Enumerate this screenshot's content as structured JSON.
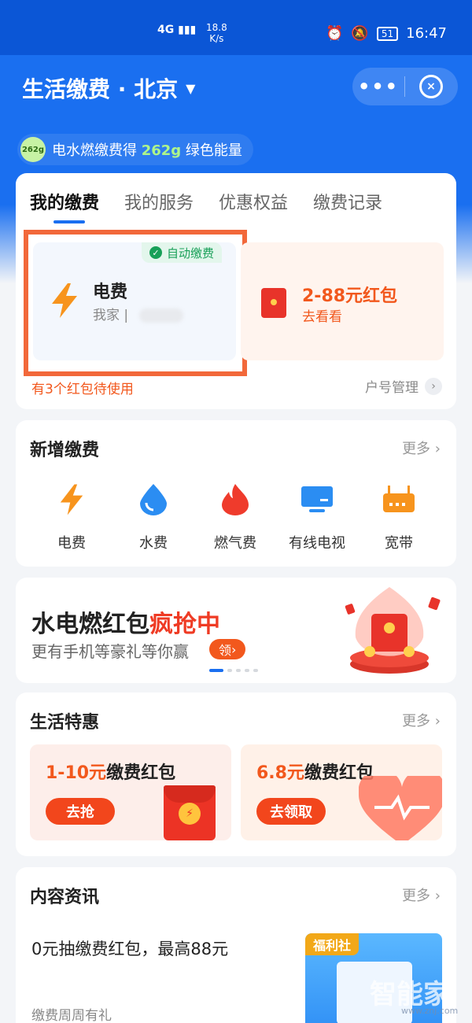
{
  "status_bar": {
    "network": "4G",
    "speed_value": "18.8",
    "speed_unit": "K/s",
    "battery": "51",
    "time": "16:47"
  },
  "header": {
    "title": "生活缴费 · 北京",
    "capsule_more": "•••"
  },
  "energy_pill": {
    "badge": "262g",
    "text_before": "电水燃缴费得 ",
    "amount": "262g",
    "text_after": " 绿色能量"
  },
  "bills_card": {
    "tabs": [
      "我的缴费",
      "我的服务",
      "优惠权益",
      "缴费记录"
    ],
    "auto_pay_tag": "自动缴费",
    "bill_name": "电费",
    "bill_owner": "我家",
    "promo_title": "2-88元红包",
    "promo_sub": "去看看",
    "footer_left": "有3个红包待使用",
    "footer_right": "户号管理"
  },
  "new_payment": {
    "title": "新增缴费",
    "more": "更多",
    "services": [
      {
        "label": "电费",
        "icon": "lightning-icon"
      },
      {
        "label": "水费",
        "icon": "water-drop-icon"
      },
      {
        "label": "燃气费",
        "icon": "flame-icon"
      },
      {
        "label": "有线电视",
        "icon": "tv-icon"
      },
      {
        "label": "宽带",
        "icon": "router-icon"
      }
    ]
  },
  "banner": {
    "title_main": "水电燃红包",
    "title_hot": "疯抢中",
    "subtitle": "更有手机等豪礼等你赢",
    "claim": "领"
  },
  "life_deals": {
    "title": "生活特惠",
    "more": "更多",
    "deals": [
      {
        "amount": "1-10元",
        "text": "缴费红包",
        "button": "去抢"
      },
      {
        "amount": "6.8元",
        "text": "缴费红包",
        "button": "去领取"
      }
    ]
  },
  "news": {
    "title": "内容资讯",
    "more": "更多",
    "headline": "0元抽缴费红包，最高88元",
    "foot": "缴费周周有礼",
    "thumb_tag": "福利社"
  },
  "watermark": {
    "logo": "智能家",
    "url": "www.znj.com"
  },
  "colors": {
    "primary": "#1a6ff0",
    "accent_orange": "#f2581d",
    "highlight_border": "#f2683a",
    "success_green": "#18a058"
  }
}
